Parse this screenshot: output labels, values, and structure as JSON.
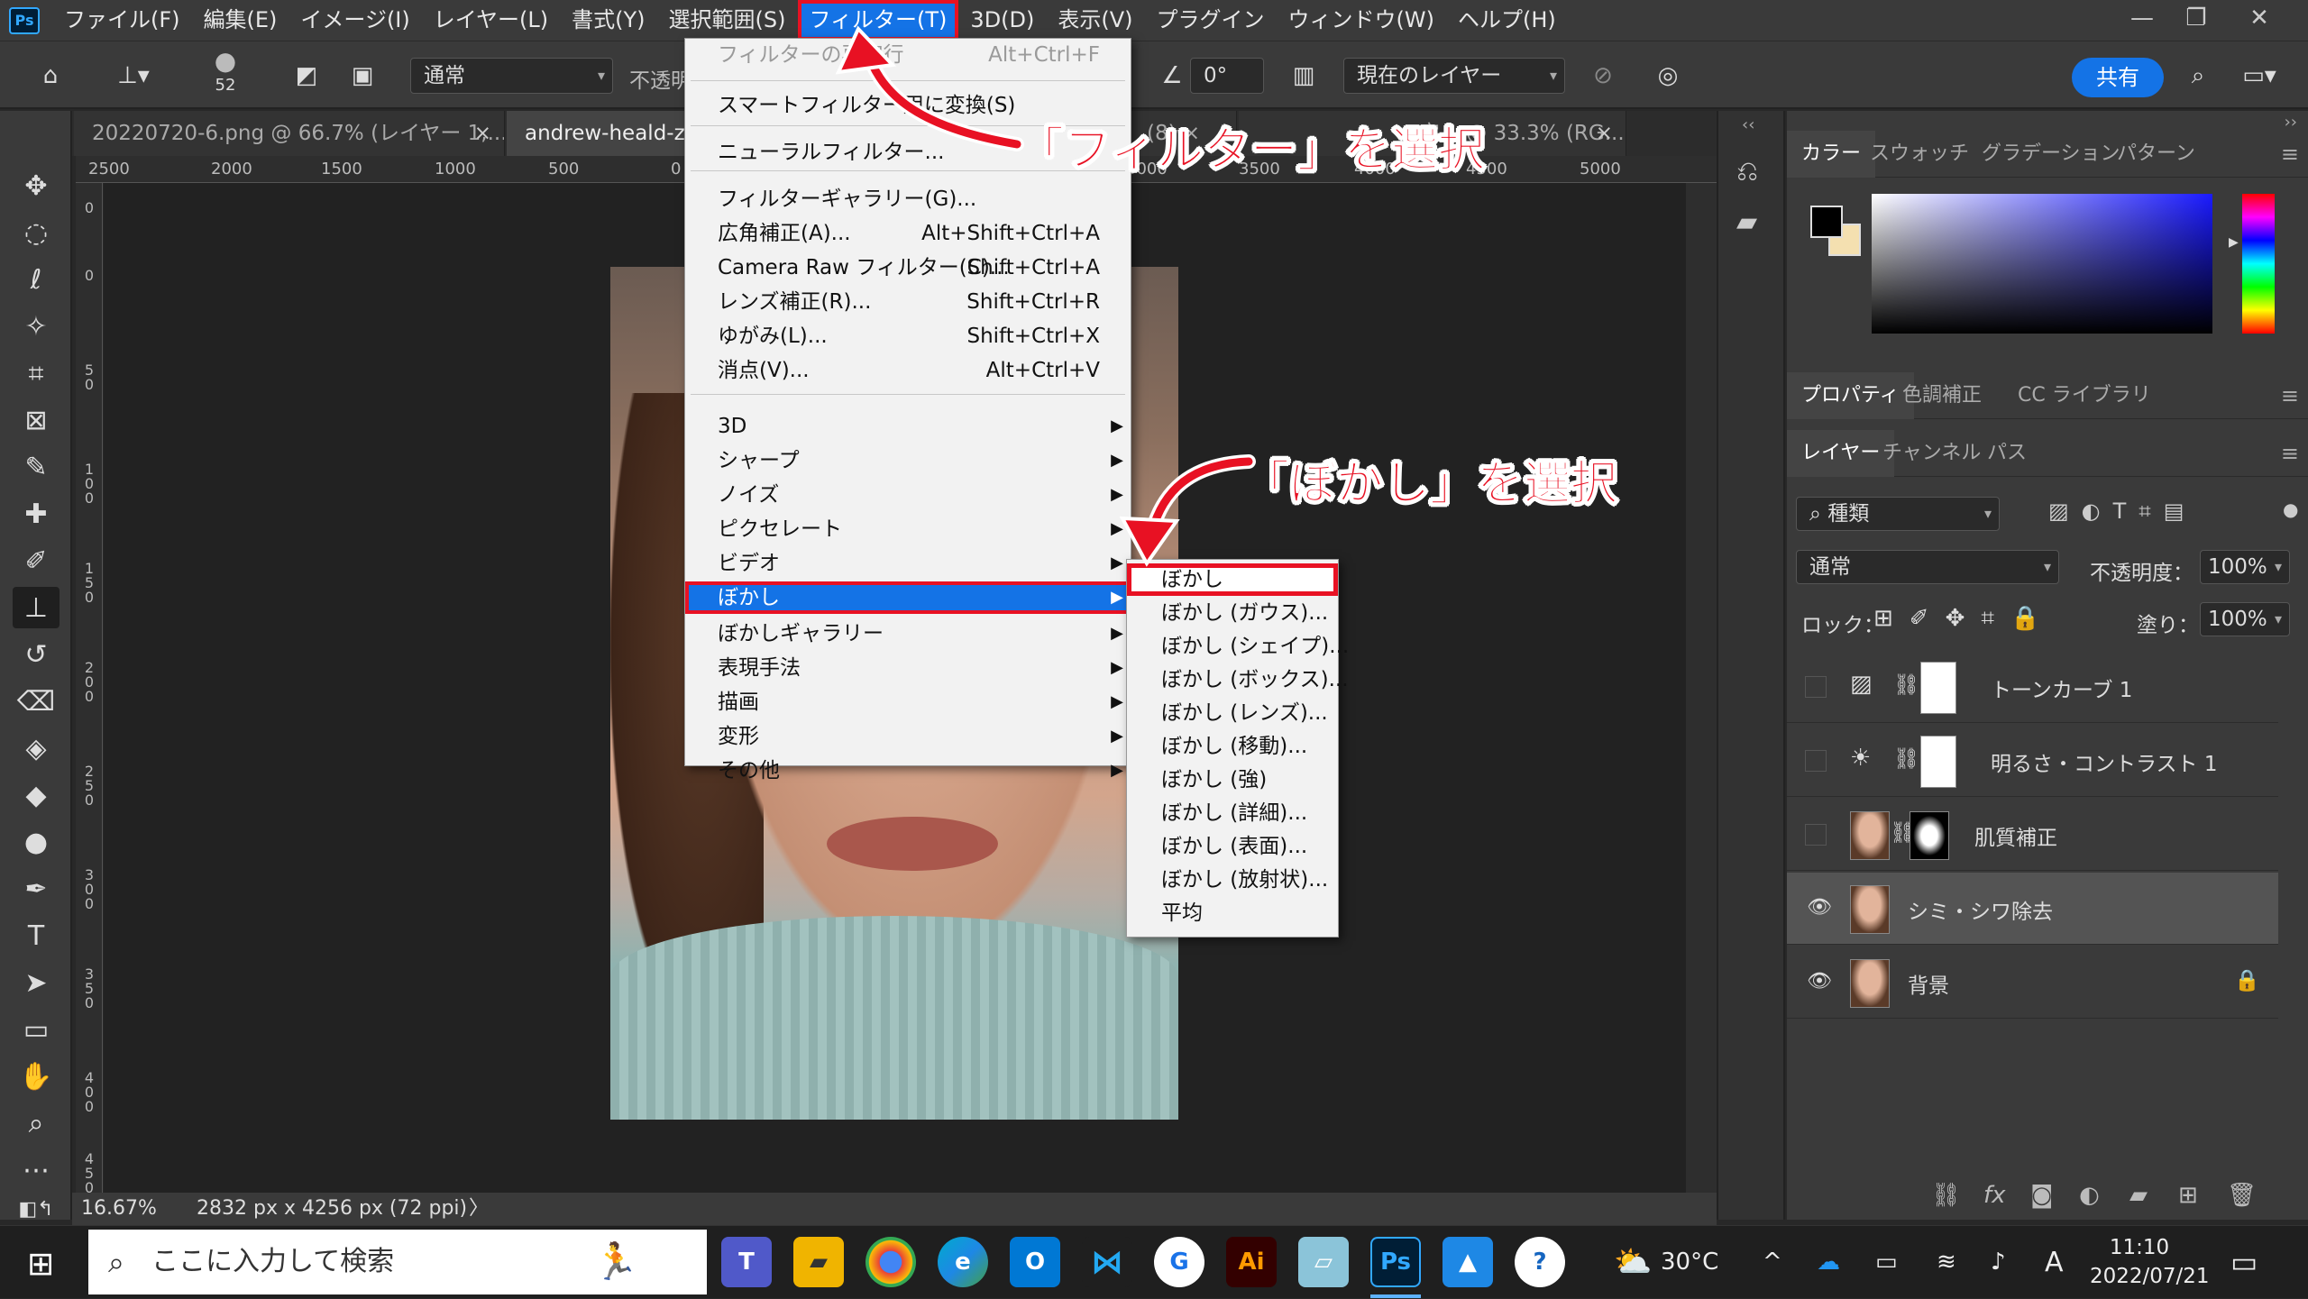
{
  "app": {
    "logo": "Ps"
  },
  "menubar": {
    "items": [
      "ファイル(F)",
      "編集(E)",
      "イメージ(I)",
      "レイヤー(L)",
      "書式(Y)",
      "選択範囲(S)",
      "フィルター(T)",
      "3D(D)",
      "表示(V)",
      "プラグイン",
      "ウィンドウ(W)",
      "ヘルプ(H)"
    ],
    "active_index": 6
  },
  "options": {
    "brush_size": "52",
    "mode_label": "通常",
    "opacity_label": "不透明",
    "angle_value": "0°",
    "sample_label": "現在のレイヤー",
    "share_label": "共有"
  },
  "tabs": [
    {
      "label": "20220720-6.png @ 66.7% (レイヤー 1,...",
      "close": "×"
    },
    {
      "label": "andrew-heald-z2",
      "close": ""
    },
    {
      "label": "(8) ×",
      "close": ""
    },
    {
      "label": "定 1 @ 33.3% (RG...",
      "close": "×"
    }
  ],
  "ruler": {
    "h_ticks": [
      "2500",
      "2000",
      "1500",
      "1000",
      "500",
      "0",
      "3000",
      "3500",
      "4000",
      "4500",
      "5000"
    ],
    "v_ticks": [
      "0",
      "0",
      "50",
      "100",
      "150",
      "200",
      "250",
      "300",
      "350",
      "400",
      "450"
    ]
  },
  "status": {
    "zoom": "16.67%",
    "doc_size": "2832 px x 4256 px (72 ppi)",
    "arrow": "〉"
  },
  "filter_menu": {
    "items": [
      {
        "label": "フィルターの再実行",
        "shortcut": "Alt+Ctrl+F",
        "disabled": true
      },
      {
        "label": "スマートフィルター用に変換(S)",
        "shortcut": ""
      },
      {
        "label": "ニューラルフィルター...",
        "shortcut": ""
      },
      {
        "label": "フィルターギャラリー(G)...",
        "shortcut": ""
      },
      {
        "label": "広角補正(A)...",
        "shortcut": "Alt+Shift+Ctrl+A"
      },
      {
        "label": "Camera Raw フィルター(C)...",
        "shortcut": "Shift+Ctrl+A"
      },
      {
        "label": "レンズ補正(R)...",
        "shortcut": "Shift+Ctrl+R"
      },
      {
        "label": "ゆがみ(L)...",
        "shortcut": "Shift+Ctrl+X"
      },
      {
        "label": "消点(V)...",
        "shortcut": "Alt+Ctrl+V"
      },
      {
        "label": "3D",
        "submenu": true
      },
      {
        "label": "シャープ",
        "submenu": true
      },
      {
        "label": "ノイズ",
        "submenu": true
      },
      {
        "label": "ピクセレート",
        "submenu": true
      },
      {
        "label": "ビデオ",
        "submenu": true
      },
      {
        "label": "ぼかし",
        "submenu": true,
        "highlighted": true
      },
      {
        "label": "ぼかしギャラリー",
        "submenu": true
      },
      {
        "label": "表現手法",
        "submenu": true
      },
      {
        "label": "描画",
        "submenu": true
      },
      {
        "label": "変形",
        "submenu": true
      },
      {
        "label": "その他",
        "submenu": true
      }
    ],
    "submenu_glyph": "▶"
  },
  "blur_submenu": {
    "items": [
      "ぼかし",
      "ぼかし (ガウス)...",
      "ぼかし (シェイプ)...",
      "ぼかし (ボックス)...",
      "ぼかし (レンズ)...",
      "ぼかし (移動)...",
      "ぼかし (強)",
      "ぼかし (詳細)...",
      "ぼかし (表面)...",
      "ぼかし (放射状)...",
      "平均"
    ]
  },
  "annotations": {
    "filter_callout": "「フィルター」を選択",
    "blur_callout": "「ぼかし」を選択",
    "color": "#e81123"
  },
  "panels": {
    "color_tabs": [
      "カラー",
      "スウォッチ",
      "グラデーション",
      "パターン"
    ],
    "prop_tabs": [
      "プロパティ",
      "色調補正",
      "CC ライブラリ"
    ],
    "layer_tabs": [
      "レイヤー",
      "チャンネル",
      "パス"
    ],
    "filter_kind": "種類",
    "blend_mode": "通常",
    "opacity_label": "不透明度：",
    "opacity_value": "100%",
    "lock_label": "ロック：",
    "fill_label": "塗り：",
    "fill_value": "100%",
    "menu_glyph": "≡"
  },
  "layers": [
    {
      "name": "トーンカーブ 1",
      "visible": false,
      "type": "adjustment"
    },
    {
      "name": "明るさ・コントラスト 1",
      "visible": false,
      "type": "adjustment"
    },
    {
      "name": "肌質補正",
      "visible": false,
      "type": "masked"
    },
    {
      "name": "シミ・シワ除去",
      "visible": true,
      "type": "image",
      "selected": true
    },
    {
      "name": "背景",
      "visible": true,
      "type": "image",
      "locked": true
    }
  ],
  "taskbar": {
    "search_placeholder": "ここに入力して検索",
    "apps": [
      "teams",
      "explorer",
      "chrome",
      "edge",
      "outlook",
      "vscode",
      "g-app",
      "Ai",
      "notes",
      "Ps",
      "photos",
      "help"
    ],
    "ai_label": "Ai",
    "ps_label": "Ps",
    "temperature": "30°C",
    "ime": "A",
    "time": "11:10",
    "date": "2022/07/21"
  }
}
